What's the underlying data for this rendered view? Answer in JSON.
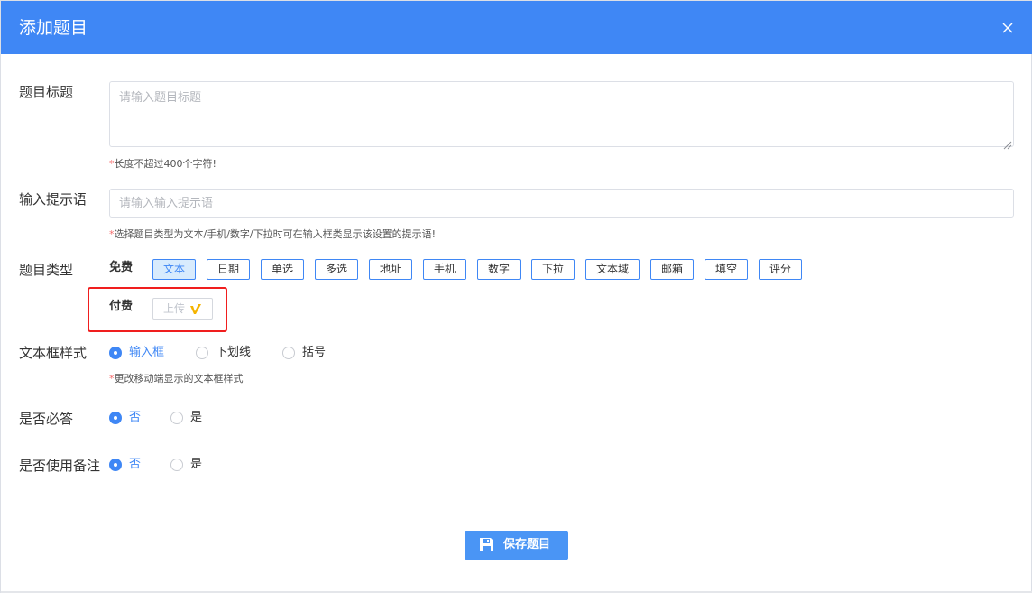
{
  "dialog": {
    "title": "添加题目",
    "close_icon": "close-icon"
  },
  "question_title": {
    "label": "题目标题",
    "value": "",
    "placeholder": "请输入题目标题",
    "hint_star": "*",
    "hint": "长度不超过400个字符!"
  },
  "input_hint": {
    "label": "输入提示语",
    "value": "",
    "placeholder": "请输入输入提示语",
    "hint_star": "*",
    "hint": "选择题目类型为文本/手机/数字/下拉时可在输入框类显示该设置的提示语!"
  },
  "question_type": {
    "label": "题目类型",
    "free_label": "免费",
    "free_types": [
      {
        "label": "文本",
        "active": true
      },
      {
        "label": "日期",
        "active": false
      },
      {
        "label": "单选",
        "active": false
      },
      {
        "label": "多选",
        "active": false
      },
      {
        "label": "地址",
        "active": false
      },
      {
        "label": "手机",
        "active": false
      },
      {
        "label": "数字",
        "active": false
      },
      {
        "label": "下拉",
        "active": false
      },
      {
        "label": "文本域",
        "active": false
      },
      {
        "label": "邮箱",
        "active": false
      },
      {
        "label": "填空",
        "active": false
      },
      {
        "label": "评分",
        "active": false
      }
    ],
    "paid_label": "付费",
    "paid_types": [
      {
        "label": "上传",
        "icon": "v-badge-icon",
        "disabled": true
      }
    ]
  },
  "textbox_style": {
    "label": "文本框样式",
    "options": [
      "输入框",
      "下划线",
      "括号"
    ],
    "selected": "输入框",
    "hint_star": "*",
    "hint": "更改移动端显示的文本框样式"
  },
  "required": {
    "label": "是否必答",
    "options": [
      "否",
      "是"
    ],
    "selected": "否"
  },
  "use_remark": {
    "label": "是否使用备注",
    "options": [
      "否",
      "是"
    ],
    "selected": "否"
  },
  "save_button": {
    "label": "保存题目",
    "icon": "save-icon"
  },
  "colors": {
    "header": "#3f87f5",
    "accent": "#3f87f5",
    "active_type_bg": "#d8ebfd",
    "highlight_box": "#f01e1e",
    "save_button": "#4a95f5",
    "required_star": "#f56c6c",
    "upload_icon": "#f5b400"
  }
}
